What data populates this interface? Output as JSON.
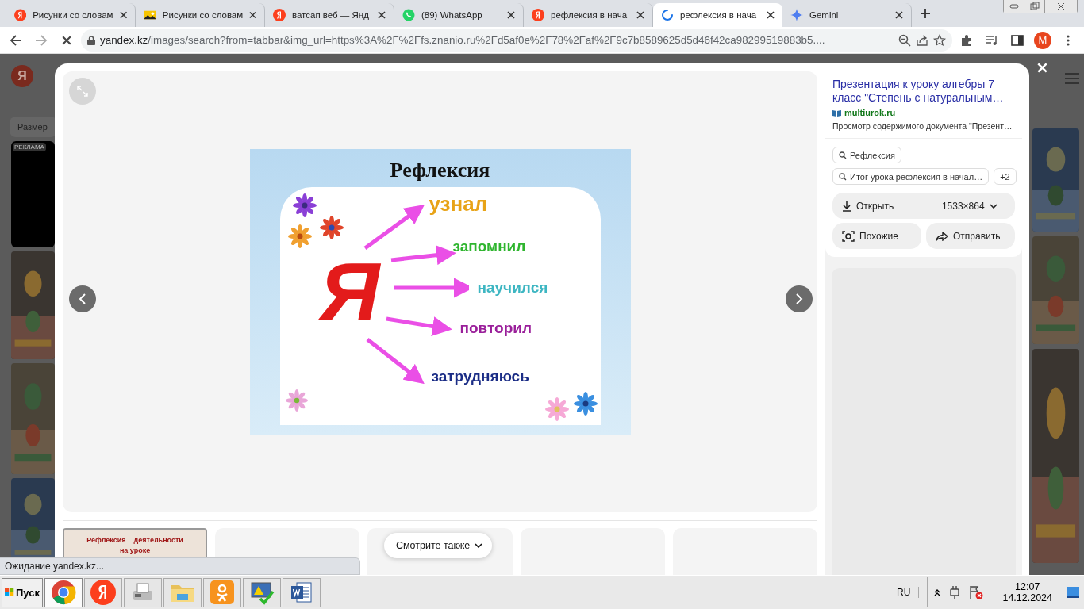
{
  "tabs": [
    {
      "title": "Рисунки со словам",
      "kind": "yandex",
      "selected": false
    },
    {
      "title": "Рисунки со словам",
      "kind": "picture",
      "selected": false
    },
    {
      "title": "ватсап веб — Янд",
      "kind": "yandex",
      "selected": false
    },
    {
      "title": "(89) WhatsApp",
      "kind": "whatsapp",
      "selected": false
    },
    {
      "title": "рефлексия в нача",
      "kind": "yandex",
      "selected": false
    },
    {
      "title": "рефлексия в нача",
      "kind": "loading",
      "selected": true
    },
    {
      "title": "Gemini",
      "kind": "gemini",
      "selected": false
    }
  ],
  "address_bar": {
    "host": "yandex.kz",
    "path": "/images/search?from=tabbar&img_url=https%3A%2F%2Ffs.znanio.ru%2Fd5af0e%2F78%2Faf%2F9c7b8589625d5d46f42ca98299519883b5....",
    "avatar": "M"
  },
  "background_page": {
    "logo": "Я",
    "size_filter": "Размер",
    "ad_label": "РЕКЛАМА"
  },
  "slide": {
    "title": "Рефлексия",
    "letter": "Я",
    "words": [
      {
        "text": "узнал",
        "color": "#e8a317"
      },
      {
        "text": "запомнил",
        "color": "#2fb52f"
      },
      {
        "text": "научился",
        "color": "#3db6c2"
      },
      {
        "text": "повторил",
        "color": "#9a1f9a"
      },
      {
        "text": "затрудняюсь",
        "color": "#1b2d86"
      }
    ]
  },
  "info": {
    "title": "Презентация к уроку алгебры 7 класс \"Степень с натуральным…",
    "site": "multiurok.ru",
    "description": "Просмотр содержимого документа \"Презент…",
    "tags": [
      "Рефлексия",
      "Итог урока рефлексия в начал…"
    ],
    "more_tags": "+2",
    "open_button": "Открыть",
    "size": "1533×864",
    "similar_button": "Похожие",
    "share_button": "Отправить"
  },
  "related": {
    "first_title": "Рефлексия    деятельности",
    "first_subtitle": "на уроке",
    "see_also": "Смотрите также"
  },
  "status": "Ожидание yandex.kz...",
  "taskbar": {
    "start": "Пуск",
    "apps": [
      {
        "kind": "chrome",
        "selected": true
      },
      {
        "kind": "yandex",
        "selected": false
      },
      {
        "kind": "fax",
        "selected": false
      },
      {
        "kind": "folder",
        "selected": false
      },
      {
        "kind": "ok",
        "selected": false
      },
      {
        "kind": "monitor",
        "selected": false
      },
      {
        "kind": "word",
        "selected": false
      }
    ],
    "language": "RU",
    "time": "12:07",
    "date": "14.12.2024"
  }
}
